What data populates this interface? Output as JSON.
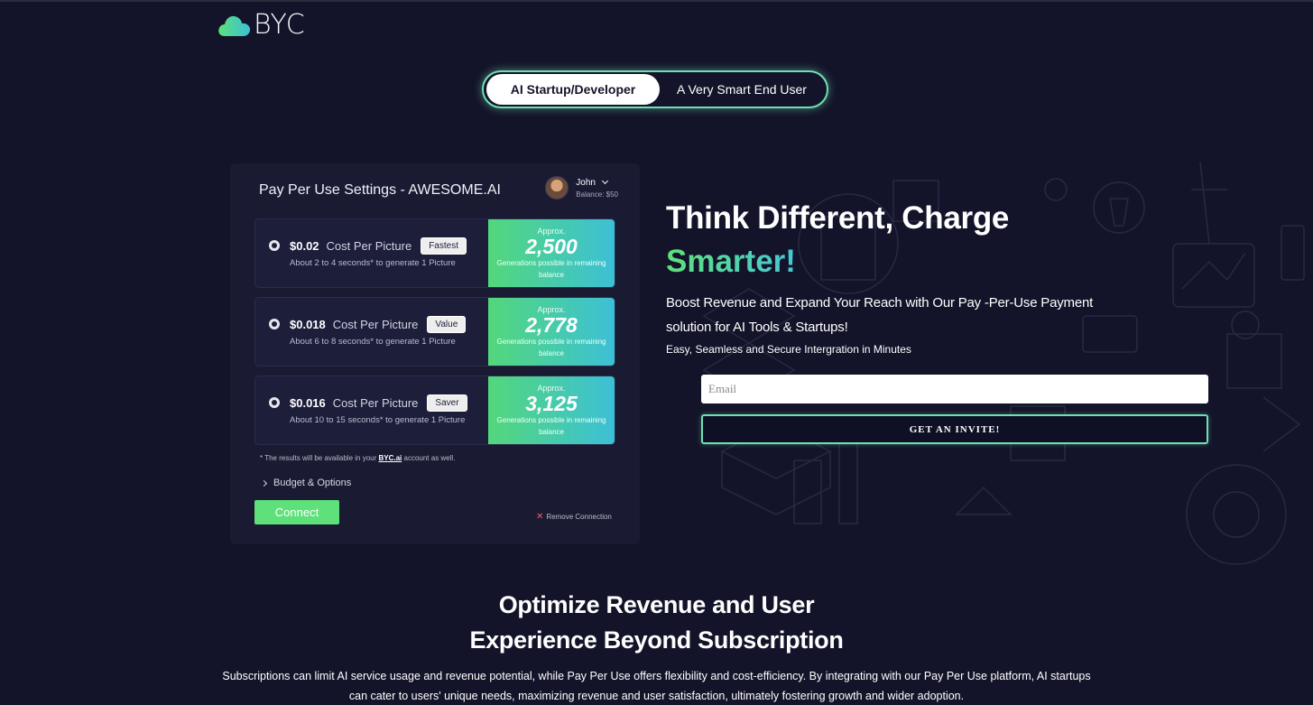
{
  "brand": {
    "name": "BYC"
  },
  "toggle": {
    "options": [
      "AI Startup/Developer",
      "A Very Smart End User"
    ],
    "active": "AI Startup/Developer"
  },
  "card": {
    "title": "Pay Per Use Settings - AWESOME.AI",
    "user": {
      "name": "John",
      "balance": "Balance: $50"
    },
    "options": [
      {
        "price": "$0.02",
        "label": "Cost Per Picture",
        "badge": "Fastest",
        "desc": "About 2 to 4 seconds* to generate 1 Picture",
        "approx": "Approx.",
        "count": "2,500",
        "gen": "Generations possible in remaining balance"
      },
      {
        "price": "$0.018",
        "label": "Cost Per Picture",
        "badge": "Value",
        "desc": "About 6 to 8 seconds* to generate 1 Picture",
        "approx": "Approx.",
        "count": "2,778",
        "gen": "Generations possible in remaining balance"
      },
      {
        "price": "$0.016",
        "label": "Cost Per Picture",
        "badge": "Saver",
        "desc": "About 10 to 15 seconds* to generate 1 Picture",
        "approx": "Approx.",
        "count": "3,125",
        "gen": "Generations possible in remaining balance"
      }
    ],
    "footnote_pre": "* The results will be available in your ",
    "footnote_link": "BYC.ai",
    "footnote_post": " account as well.",
    "budget": "Budget & Options",
    "connect": "Connect",
    "remove": "Remove Connection"
  },
  "hero": {
    "title_line1": "Think Different, Charge",
    "title_line2": "Smarter!",
    "subtitle": "Boost Revenue and Expand Your Reach with Our Pay -Per-Use Payment solution for AI Tools & Startups!",
    "small": "Easy, Seamless and Secure Intergration in Minutes",
    "email_placeholder": "Email",
    "cta": "GET AN INVITE!"
  },
  "section": {
    "title_line1": "Optimize Revenue and User",
    "title_line2": "Experience Beyond Subscription",
    "paragraph": "Subscriptions can limit AI service usage and revenue potential, while Pay Per Use offers flexibility and cost-efficiency. By integrating with our Pay Per Use platform, AI startups can cater to users' unique needs, maximizing revenue and user satisfaction, ultimately fostering growth and wider adoption."
  },
  "colors": {
    "background": "#131429",
    "accent_green": "#5ee07a",
    "accent_teal": "#3cc0d6",
    "toggle_border": "#6fe0b4"
  },
  "icons": [
    "cloud-logo-icon",
    "chevron-down-icon",
    "radio-icon",
    "chevron-right-icon",
    "close-icon"
  ]
}
